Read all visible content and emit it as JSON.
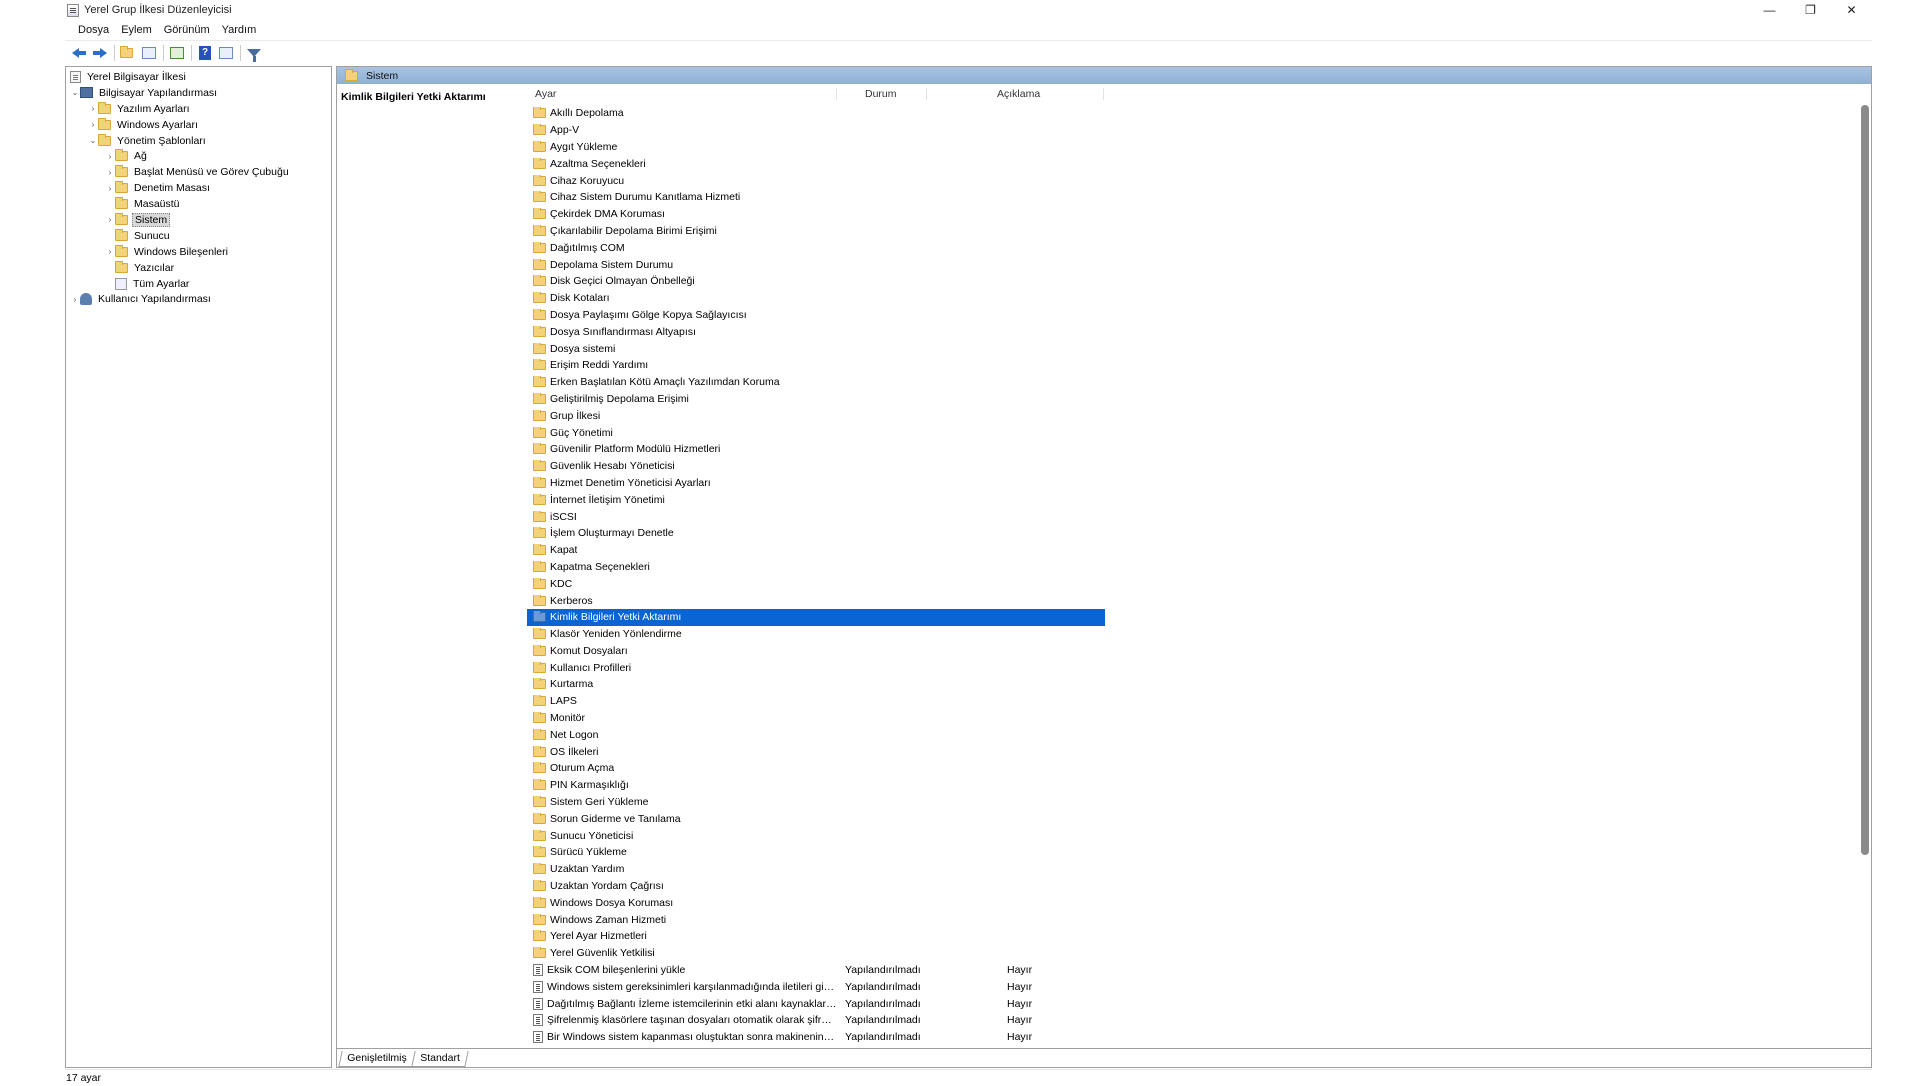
{
  "window": {
    "title": "Yerel Grup İlkesi Düzenleyicisi",
    "controls": {
      "minimize": "—",
      "restore": "❐",
      "close": "✕"
    }
  },
  "menu": [
    "Dosya",
    "Eylem",
    "Görünüm",
    "Yardım"
  ],
  "toolbar": {
    "icons": [
      "back-arrow-icon",
      "forward-arrow-icon",
      "up-folder-icon",
      "show-hide-tree-icon",
      "export-list-icon",
      "help-icon",
      "properties-icon",
      "filter-icon"
    ],
    "help_glyph": "?"
  },
  "tree": {
    "root": "Yerel Bilgisayar İlkesi",
    "computer_config": "Bilgisayar Yapılandırması",
    "software_settings": "Yazılım Ayarları",
    "windows_settings": "Windows Ayarları",
    "admin_templates": "Yönetim Şablonları",
    "items": [
      "Ağ",
      "Başlat Menüsü ve Görev Çubuğu",
      "Denetim Masası",
      "Masaüstü",
      "Sistem",
      "Sunucu",
      "Windows Bileşenleri",
      "Yazıcılar",
      "Tüm Ayarlar"
    ],
    "user_config": "Kullanıcı Yapılandırması",
    "expand_glyph": "›",
    "collapse_glyph": "⌄"
  },
  "right": {
    "header": "Sistem",
    "selected_title": "Kimlik Bilgileri Yetki Aktarımı",
    "columns": {
      "name": "Ayar",
      "state": "Durum",
      "comment": "Açıklama"
    },
    "folders": [
      "Akıllı Depolama",
      "App-V",
      "Aygıt Yükleme",
      "Azaltma Seçenekleri",
      "Cihaz Koruyucu",
      "Cihaz Sistem Durumu Kanıtlama Hizmeti",
      "Çekirdek DMA Koruması",
      "Çıkarılabilir Depolama Birimi Erişimi",
      "Dağıtılmış COM",
      "Depolama Sistem Durumu",
      "Disk Geçici Olmayan Önbelleği",
      "Disk Kotaları",
      "Dosya Paylaşımı Gölge Kopya Sağlayıcısı",
      "Dosya Sınıflandırması Altyapısı",
      "Dosya sistemi",
      "Erişim Reddi Yardımı",
      "Erken Başlatılan Kötü Amaçlı Yazılımdan Koruma",
      "Geliştirilmiş Depolama Erişimi",
      "Grup İlkesi",
      "Güç Yönetimi",
      "Güvenilir Platform Modülü Hizmetleri",
      "Güvenlik Hesabı Yöneticisi",
      "Hizmet Denetim Yöneticisi Ayarları",
      "İnternet İletişim Yönetimi",
      "iSCSI",
      "İşlem Oluşturmayı Denetle",
      "Kapat",
      "Kapatma Seçenekleri",
      "KDC",
      "Kerberos",
      "Kimlik Bilgileri Yetki Aktarımı",
      "Klasör Yeniden Yönlendirme",
      "Komut Dosyaları",
      "Kullanıcı Profilleri",
      "Kurtarma",
      "LAPS",
      "Monitör",
      "Net Logon",
      "OS İlkeleri",
      "Oturum Açma",
      "PIN Karmaşıklığı",
      "Sistem Geri Yükleme",
      "Sorun Giderme ve Tanılama",
      "Sunucu Yöneticisi",
      "Sürücü Yükleme",
      "Uzaktan Yardım",
      "Uzaktan Yordam Çağrısı",
      "Windows Dosya Koruması",
      "Windows Zaman Hizmeti",
      "Yerel Ayar Hizmetleri",
      "Yerel Güvenlik Yetkilisi"
    ],
    "selected_index": 30,
    "settings": [
      {
        "name": "Eksik COM bileşenlerini yükle",
        "state": "Yapılandırılmadı",
        "comment": "Hayır"
      },
      {
        "name": "Windows sistem gereksinimleri karşılanmadığında iletileri gizle",
        "state": "Yapılandırılmadı",
        "comment": "Hayır"
      },
      {
        "name": "Dağıtılmış Bağlantı İzleme istemcilerinin etki alanı kaynakları...",
        "state": "Yapılandırılmadı",
        "comment": "Hayır"
      },
      {
        "name": "Şifrelenmiş klasörlere taşınan dosyaları otomatik olarak şifrel...",
        "state": "Yapılandırılmadı",
        "comment": "Hayır"
      },
      {
        "name": "Bir Windows sistem kapanması oluştuktan sonra makinenin a...",
        "state": "Yapılandırılmadı",
        "comment": "Hayır"
      }
    ]
  },
  "tabs": [
    "Genişletilmiş",
    "Standart"
  ],
  "status": "17 ayar"
}
